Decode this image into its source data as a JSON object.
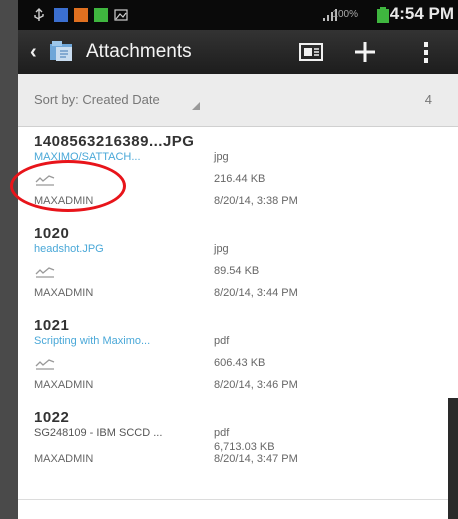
{
  "status_bar": {
    "battery_percent": "100%",
    "time": "4:54 PM"
  },
  "action_bar": {
    "back": "‹",
    "title": "Attachments",
    "icons": [
      "back-icon",
      "attachments-app-icon",
      "card-icon",
      "plus-icon",
      "overflow-menu-icon"
    ],
    "plus": "+"
  },
  "sort_bar": {
    "label": "Sort by: Created Date",
    "count": "4"
  },
  "attachments": [
    {
      "id": "1408563216389...JPG",
      "desc": "MAXIMO/SATTACH...",
      "type": "jpg",
      "size": "216.44 KB",
      "user": "MAXADMIN",
      "date": "8/20/14, 3:38 PM"
    },
    {
      "id": "1020",
      "desc": "headshot.JPG",
      "type": "jpg",
      "size": "89.54 KB",
      "user": "MAXADMIN",
      "date": "8/20/14, 3:44 PM"
    },
    {
      "id": "1021",
      "desc": "Scripting with Maximo...",
      "type": "pdf",
      "size": "606.43 KB",
      "user": "MAXADMIN",
      "date": "8/20/14, 3:46 PM"
    },
    {
      "id": "1022",
      "desc": "SG248109 - IBM SCCD ...",
      "type": "pdf",
      "size": "6,713.03 KB",
      "user": "MAXADMIN",
      "date": "8/20/14, 3:47 PM"
    }
  ],
  "colors": {
    "link": "#4aa8d8",
    "annotation": "#e8141a",
    "status_green": "#3fb63f"
  }
}
